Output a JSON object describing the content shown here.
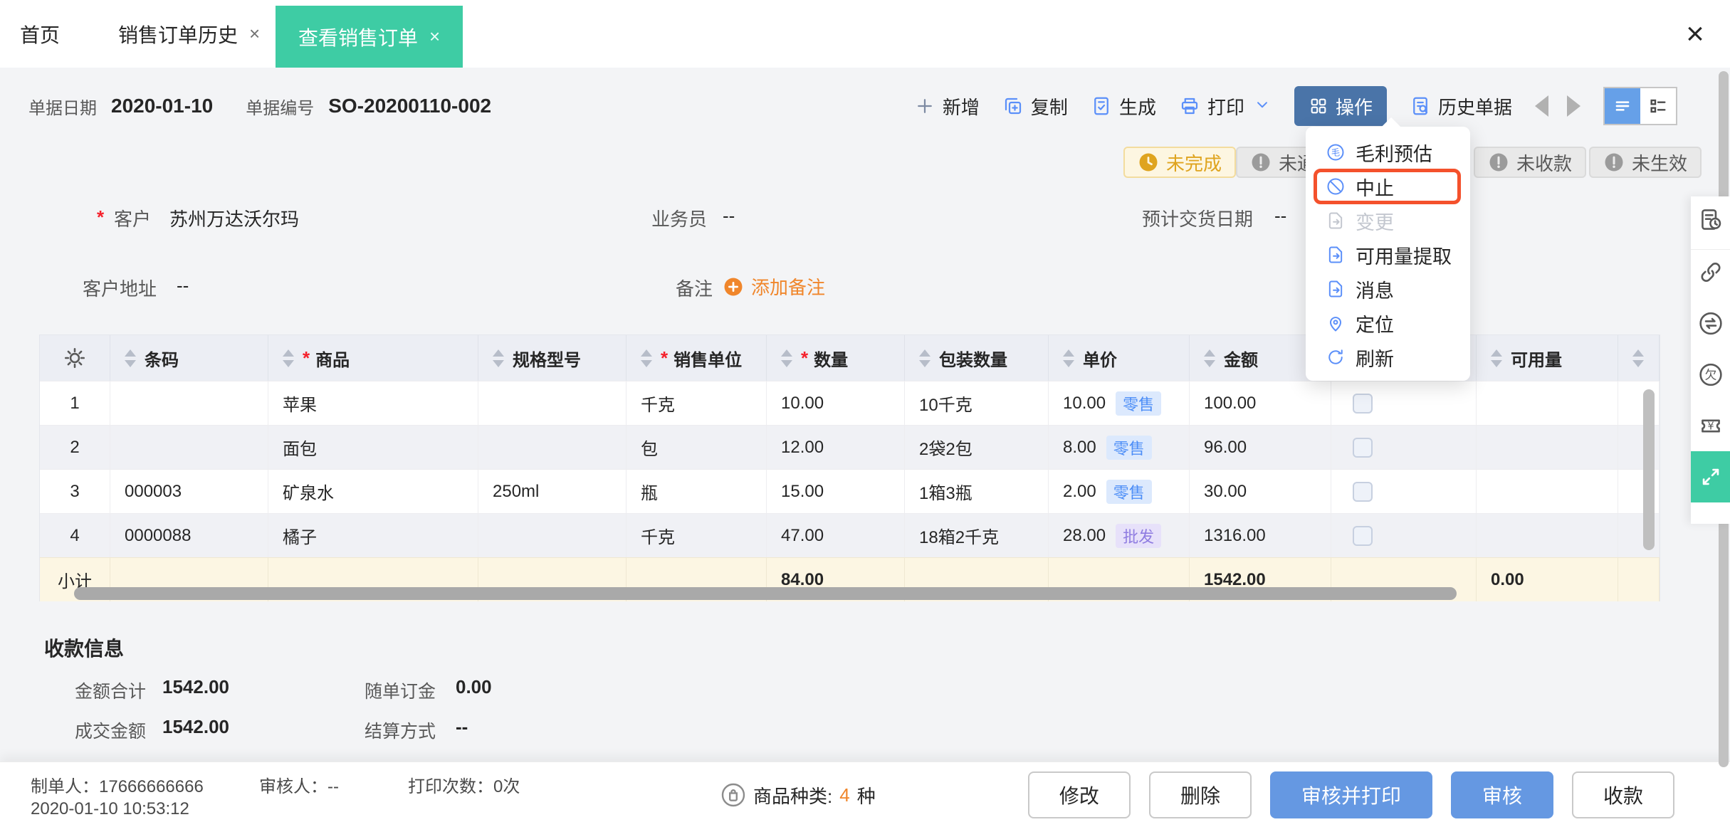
{
  "tabs": {
    "home": "首页",
    "history": "销售订单历史",
    "active": "查看销售订单",
    "close": "×"
  },
  "window": {
    "close": "×"
  },
  "doc_header": {
    "date_label": "单据日期",
    "date_value": "2020-01-10",
    "no_label": "单据编号",
    "no_value": "SO-20200110-002"
  },
  "toolbar": {
    "add": "新增",
    "copy": "复制",
    "generate": "生成",
    "print": "打印",
    "action": "操作",
    "history": "历史单据"
  },
  "action_menu": {
    "items": [
      {
        "label": "毛利预估",
        "icon": "profit-icon"
      },
      {
        "label": "中止",
        "icon": "stop-icon",
        "highlighted": true
      },
      {
        "label": "变更",
        "icon": "doc-arrow-icon",
        "disabled": true
      },
      {
        "label": "可用量提取",
        "icon": "doc-arrow-icon"
      },
      {
        "label": "消息",
        "icon": "doc-arrow-icon"
      },
      {
        "label": "定位",
        "icon": "pin-icon"
      },
      {
        "label": "刷新",
        "icon": "refresh-icon"
      }
    ]
  },
  "status_badges": [
    {
      "label": "未完成",
      "type": "warning",
      "icon": "clock-icon"
    },
    {
      "label": "未通知",
      "type": "default",
      "icon": "exclamation-icon"
    },
    {
      "label": "未收款",
      "type": "default",
      "icon": "exclamation-icon"
    },
    {
      "label": "未生效",
      "type": "default",
      "icon": "exclamation-icon"
    }
  ],
  "info": {
    "required_mark": "*",
    "customer_label": "客户",
    "customer_value": "苏州万达沃尔玛",
    "salesman_label": "业务员",
    "salesman_value": "--",
    "delivery_label": "预计交货日期",
    "delivery_value": "--",
    "address_label": "客户地址",
    "address_value": "--",
    "remark_label": "备注",
    "add_remark": "添加备注"
  },
  "table": {
    "required_mark": "*",
    "columns": [
      {
        "label": "条码",
        "required": false
      },
      {
        "label": "商品",
        "required": true
      },
      {
        "label": "规格型号",
        "required": false
      },
      {
        "label": "销售单位",
        "required": true
      },
      {
        "label": "数量",
        "required": true
      },
      {
        "label": "包装数量",
        "required": false
      },
      {
        "label": "单价",
        "required": false
      },
      {
        "label": "金额",
        "required": false
      },
      {
        "label": "",
        "required": false
      },
      {
        "label": "可用量",
        "required": false
      }
    ],
    "rows": [
      {
        "seq": "1",
        "barcode": "",
        "product": "苹果",
        "spec": "",
        "unit": "千克",
        "qty": "10.00",
        "pack": "10千克",
        "price": "10.00",
        "price_tag": "零售",
        "tag_type": "retail",
        "amount": "100.00",
        "available": ""
      },
      {
        "seq": "2",
        "barcode": "",
        "product": "面包",
        "spec": "",
        "unit": "包",
        "qty": "12.00",
        "pack": "2袋2包",
        "price": "8.00",
        "price_tag": "零售",
        "tag_type": "retail",
        "amount": "96.00",
        "available": ""
      },
      {
        "seq": "3",
        "barcode": "000003",
        "product": "矿泉水",
        "spec": "250ml",
        "unit": "瓶",
        "qty": "15.00",
        "pack": "1箱3瓶",
        "price": "2.00",
        "price_tag": "零售",
        "tag_type": "retail",
        "amount": "30.00",
        "available": ""
      },
      {
        "seq": "4",
        "barcode": "0000088",
        "product": "橘子",
        "spec": "",
        "unit": "千克",
        "qty": "47.00",
        "pack": "18箱2千克",
        "price": "28.00",
        "price_tag": "批发",
        "tag_type": "wholesale",
        "amount": "1316.00",
        "available": ""
      }
    ],
    "subtotal": {
      "label": "小计",
      "qty": "84.00",
      "amount": "1542.00",
      "available": "0.00"
    }
  },
  "payment": {
    "title": "收款信息",
    "total_label": "金额合计",
    "total_value": "1542.00",
    "deposit_label": "随单订金",
    "deposit_value": "0.00",
    "deal_label": "成交金额",
    "deal_value": "1542.00",
    "settlement_label": "结算方式",
    "settlement_value": "--"
  },
  "footer": {
    "maker_label": "制单人：",
    "maker_value": "17666666666",
    "created_time": "2020-01-10 10:53:12",
    "auditor_label": "审核人：",
    "auditor_value": "--",
    "print_label": "打印次数：",
    "print_value": "0次",
    "category_label": "商品种类:",
    "category_count": "4",
    "category_unit": "种",
    "buttons": [
      {
        "label": "修改",
        "primary": false
      },
      {
        "label": "删除",
        "primary": false
      },
      {
        "label": "审核并打印",
        "primary": true
      },
      {
        "label": "审核",
        "primary": true
      },
      {
        "label": "收款",
        "primary": false
      }
    ]
  },
  "sidebar": {
    "icons": [
      "doc-clock-icon",
      "link-icon",
      "transfer-icon",
      "owe-icon",
      "money-ticket-icon",
      "expand-icon"
    ]
  },
  "colors": {
    "accent_teal": "#3ecca4",
    "primary_blue": "#6598e2",
    "action_button_blue": "#4a74a8",
    "highlight_red": "#f4512c",
    "warning_orange": "#dfa41f",
    "link_icon_blue": "#5b8ff9",
    "retail_tag_blue": "#4d8ef7",
    "wholesale_tag_purple": "#8f7ce1",
    "remark_orange": "#f0862b"
  }
}
